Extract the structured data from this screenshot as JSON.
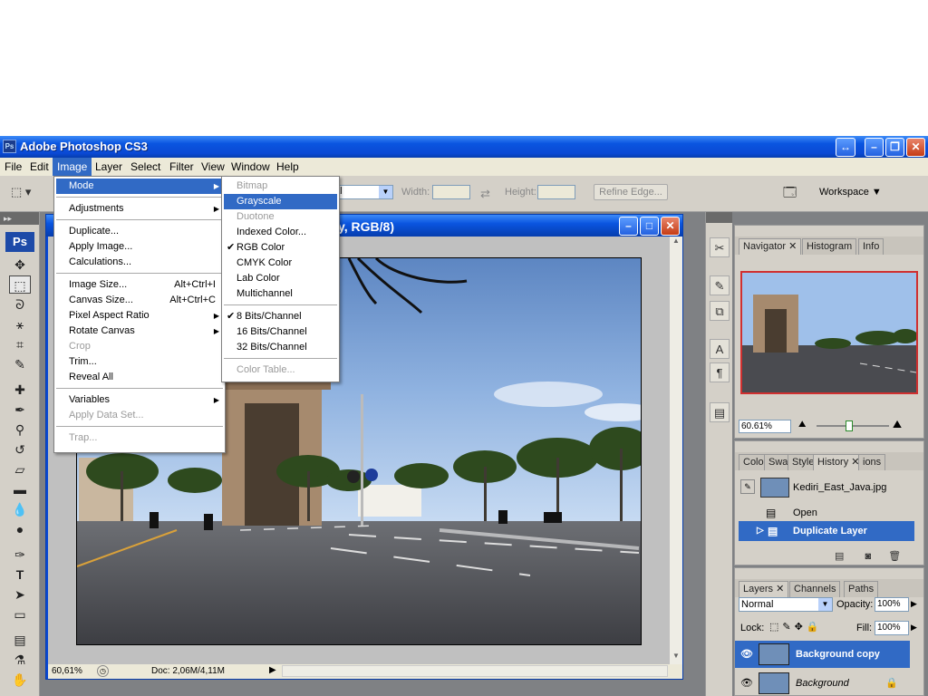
{
  "app": {
    "title": "Adobe Photoshop CS3",
    "logo": "Ps"
  },
  "menubar": [
    "File",
    "Edit",
    "Image",
    "Layer",
    "Select",
    "Filter",
    "View",
    "Window",
    "Help"
  ],
  "options": {
    "style_value": "al",
    "width_label": "Width:",
    "height_label": "Height:",
    "refine_edge": "Refine Edge...",
    "workspace": "Workspace"
  },
  "document": {
    "title_visible": "y, RGB/8)",
    "zoom": "60,61%",
    "doc_info": "Doc: 2,06M/4,11M"
  },
  "image_menu": [
    {
      "label": "Mode",
      "submenu": true,
      "highlight": true
    },
    {
      "sep": true
    },
    {
      "label": "Adjustments",
      "submenu": true
    },
    {
      "sep": true
    },
    {
      "label": "Duplicate..."
    },
    {
      "label": "Apply Image..."
    },
    {
      "label": "Calculations..."
    },
    {
      "sep": true
    },
    {
      "label": "Image Size...",
      "shortcut": "Alt+Ctrl+I"
    },
    {
      "label": "Canvas Size...",
      "shortcut": "Alt+Ctrl+C"
    },
    {
      "label": "Pixel Aspect Ratio",
      "submenu": true
    },
    {
      "label": "Rotate Canvas",
      "submenu": true
    },
    {
      "label": "Crop",
      "disabled": true
    },
    {
      "label": "Trim..."
    },
    {
      "label": "Reveal All"
    },
    {
      "sep": true
    },
    {
      "label": "Variables",
      "submenu": true
    },
    {
      "label": "Apply Data Set...",
      "disabled": true
    },
    {
      "sep": true
    },
    {
      "label": "Trap...",
      "disabled": true
    }
  ],
  "mode_submenu": [
    {
      "label": "Bitmap",
      "disabled": true
    },
    {
      "label": "Grayscale",
      "highlight": true
    },
    {
      "label": "Duotone",
      "disabled": true
    },
    {
      "label": "Indexed Color..."
    },
    {
      "label": "RGB Color",
      "checked": true
    },
    {
      "label": "CMYK Color"
    },
    {
      "label": "Lab Color"
    },
    {
      "label": "Multichannel"
    },
    {
      "sep": true
    },
    {
      "label": "8 Bits/Channel",
      "checked": true
    },
    {
      "label": "16 Bits/Channel"
    },
    {
      "label": "32 Bits/Channel"
    },
    {
      "sep": true
    },
    {
      "label": "Color Table...",
      "disabled": true
    }
  ],
  "navigator": {
    "tabs": [
      "Navigator",
      "Histogram",
      "Info"
    ],
    "zoom": "60.61%"
  },
  "history": {
    "tabs": [
      "Colo",
      "Swa",
      "Style",
      "History",
      "ions"
    ],
    "snapshot": "Kediri_East_Java.jpg",
    "items": [
      "Open",
      "Duplicate Layer"
    ]
  },
  "layers": {
    "tabs": [
      "Layers",
      "Channels",
      "Paths"
    ],
    "blend": "Normal",
    "opacity_label": "Opacity:",
    "opacity": "100%",
    "lock_label": "Lock:",
    "fill_label": "Fill:",
    "fill": "100%",
    "items": [
      "Background copy",
      "Background"
    ]
  }
}
